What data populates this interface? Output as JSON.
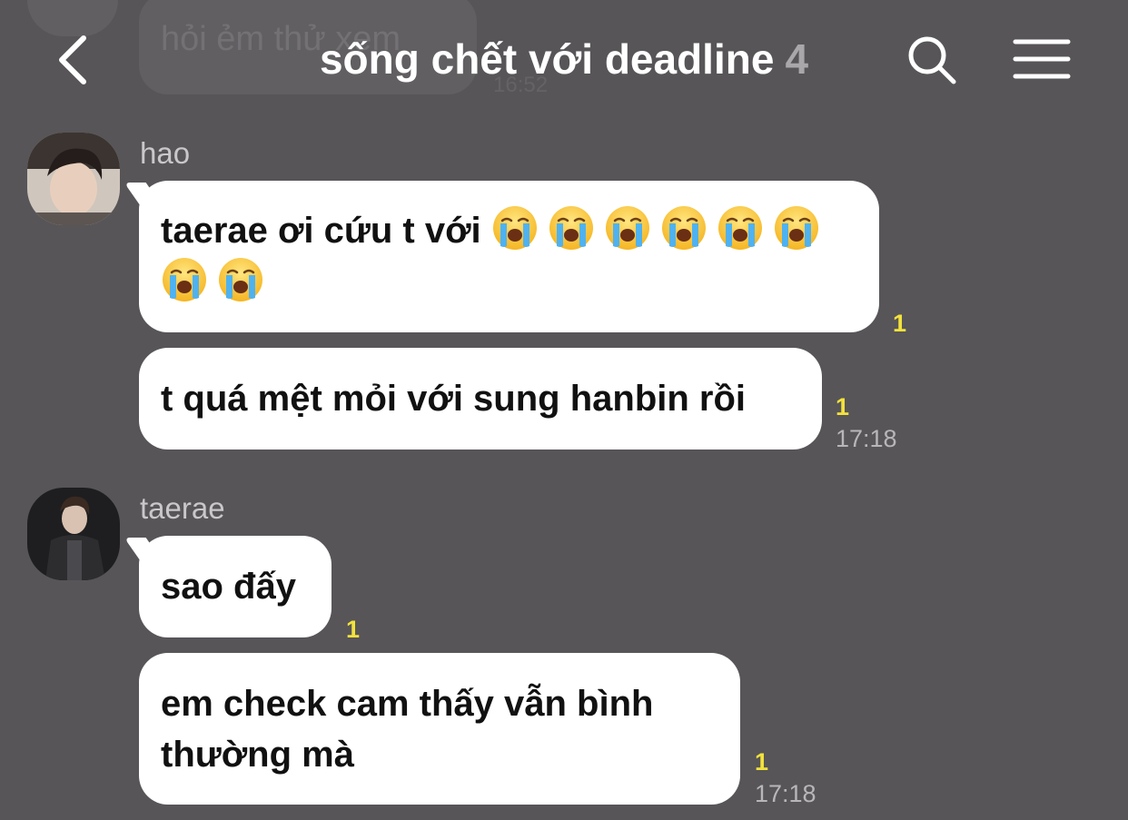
{
  "header": {
    "title": "sống chết với deadline",
    "member_count": "4",
    "back_icon": "chevron-left-icon",
    "search_icon": "search-icon",
    "menu_icon": "hamburger-menu-icon"
  },
  "previous_message": {
    "text": "hỏi ẻm thử xem",
    "time": "16:52"
  },
  "messages": [
    {
      "sender": "hao",
      "bubbles": [
        {
          "text": "taerae ơi cứu t với",
          "emoji_count": 8,
          "emoji": "loudly-crying-face",
          "read": "1",
          "time": ""
        },
        {
          "text": "t quá mệt mỏi với sung hanbin rồi",
          "read": "1",
          "time": "17:18"
        }
      ]
    },
    {
      "sender": "taerae",
      "bubbles": [
        {
          "text": "sao đấy",
          "read": "1",
          "time": ""
        },
        {
          "text": "em check cam thấy vẫn bình thường mà",
          "read": "1",
          "time": "17:18"
        }
      ]
    }
  ],
  "colors": {
    "background": "#575558",
    "bubble": "#ffffff",
    "read_count": "#f3e23c",
    "timestamp": "#b8b6b9"
  }
}
